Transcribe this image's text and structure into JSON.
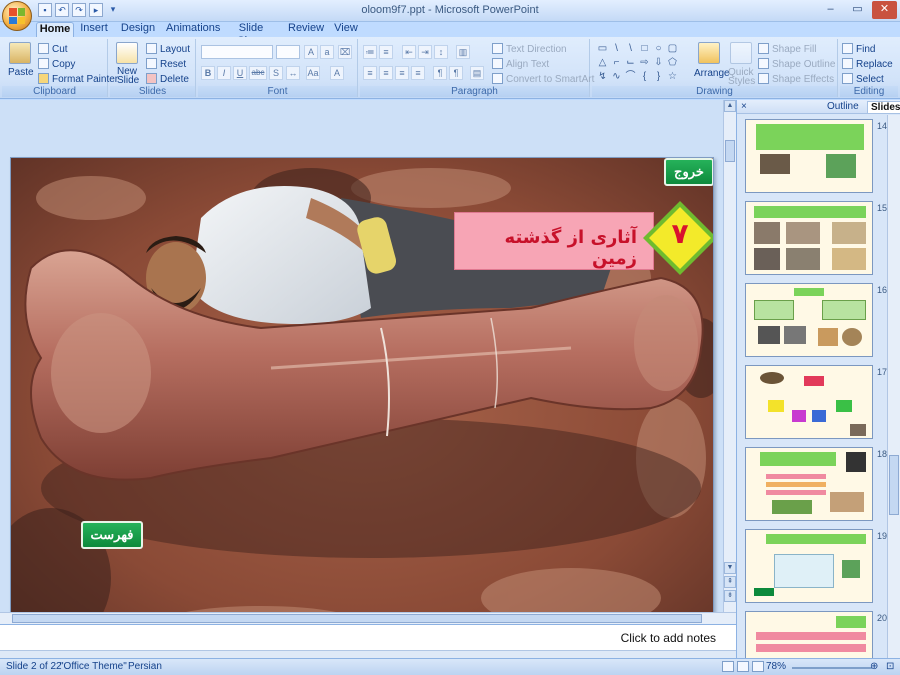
{
  "window": {
    "title": "oloom9f7.ppt - Microsoft PowerPoint",
    "controls": [
      "–",
      "▭",
      "✕"
    ]
  },
  "tabs": [
    {
      "label": "Home",
      "active": true
    },
    {
      "label": "Insert"
    },
    {
      "label": "Design"
    },
    {
      "label": "Animations"
    },
    {
      "label": "Slide Show"
    },
    {
      "label": "Review"
    },
    {
      "label": "View"
    }
  ],
  "ribbon": {
    "clipboard": {
      "label": "Clipboard",
      "paste": "Paste",
      "cut": "Cut",
      "copy": "Copy",
      "format_painter": "Format Painter"
    },
    "slides": {
      "label": "Slides",
      "new_slide": "New Slide",
      "layout": "Layout",
      "reset": "Reset",
      "delete": "Delete"
    },
    "font": {
      "label": "Font",
      "bold": "B",
      "italic": "I",
      "underline": "U",
      "strike": "abc",
      "shadow": "S"
    },
    "paragraph": {
      "label": "Paragraph",
      "text_direction": "Text Direction",
      "align_text": "Align Text",
      "convert_smartart": "Convert to SmartArt"
    },
    "drawing": {
      "label": "Drawing",
      "arrange": "Arrange",
      "quick_styles": "Quick Styles",
      "shape_fill": "Shape Fill",
      "shape_outline": "Shape Outline",
      "shape_effects": "Shape Effects"
    },
    "editing": {
      "label": "Editing",
      "find": "Find",
      "replace": "Replace",
      "select": "Select"
    }
  },
  "slide": {
    "title": "آثاری از گذشته زمین",
    "number": "۷",
    "exit_button": "خروج",
    "index_button": "فهرست"
  },
  "notes": {
    "placeholder": "Click to add notes"
  },
  "pane": {
    "tabs": [
      {
        "label": "Outline"
      },
      {
        "label": "Slides",
        "active": true
      }
    ],
    "close": "×",
    "thumbnails": [
      {
        "num": "14"
      },
      {
        "num": "15"
      },
      {
        "num": "16"
      },
      {
        "num": "17"
      },
      {
        "num": "18"
      },
      {
        "num": "19"
      },
      {
        "num": "20"
      }
    ]
  },
  "status": {
    "slide_info": "Slide 2 of 22",
    "theme": "\"Office Theme\"",
    "language": "Persian",
    "zoom": "78%"
  },
  "colors": {
    "ribbon_bg": "#d2e3f9",
    "workspace_bg": "#cde0f7",
    "banner_pink": "#f7a5b5",
    "title_red": "#c7112a",
    "diamond_yellow": "#f3ea2a",
    "diamond_green": "#6fbb2f",
    "button_green": "#0d8a3c"
  }
}
